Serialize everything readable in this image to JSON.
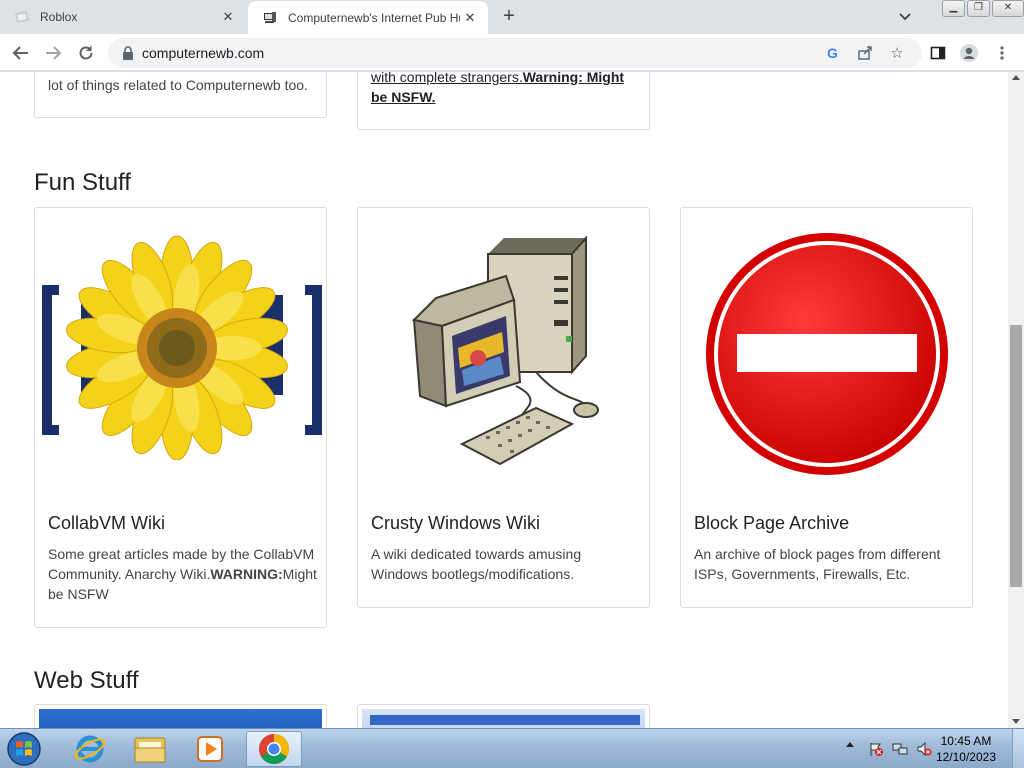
{
  "tabs": [
    {
      "title": "Roblox",
      "active": false
    },
    {
      "title": "Computernewb's Internet Pub Hu",
      "active": true
    }
  ],
  "toolbar": {
    "url": "computernewb.com"
  },
  "page": {
    "top_cards": [
      {
        "text": "lot of things related to Computernewb too."
      },
      {
        "link_text": "with complete strangers.",
        "warning": "Warning: Might be NSFW."
      }
    ],
    "fun_section": {
      "heading": "Fun Stuff",
      "cards": [
        {
          "title": "CollabVM Wiki",
          "text_before": "Some great articles made by the CollabVM Community. Anarchy Wiki.",
          "warning": "WARNING:",
          "text_after": "Might be NSFW",
          "image": "sunflower-bracket-logo"
        },
        {
          "title": "Crusty Windows Wiki",
          "text": "A wiki dedicated towards amusing Windows bootlegs/modifications.",
          "image": "retro-computer-icon"
        },
        {
          "title": "Block Page Archive",
          "text": "An archive of block pages from different ISPs, Governments, Firewalls, Etc.",
          "image": "no-entry-sign"
        }
      ]
    },
    "web_section": {
      "heading": "Web Stuff"
    }
  },
  "taskbar": {
    "apps": [
      "internet-explorer",
      "file-explorer",
      "media-player",
      "chrome"
    ],
    "time": "10:45 AM",
    "date": "12/10/2023"
  },
  "colors": {
    "accent_red": "#e00000",
    "sunflower": "#f5d21a",
    "bracket_blue": "#1b2f6b"
  }
}
